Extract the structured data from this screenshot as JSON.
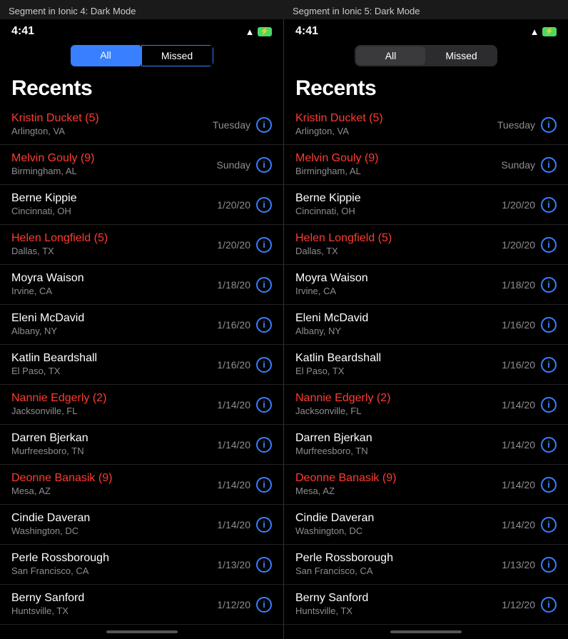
{
  "captions": {
    "left": "Segment in Ionic 4: Dark Mode",
    "right": "Segment in Ionic 5: Dark Mode"
  },
  "statusBar": {
    "time": "4:41",
    "wifi": "📶",
    "battery": "⚡"
  },
  "segment": {
    "allLabel": "All",
    "missedLabel": "Missed"
  },
  "recentsTitle": "Recents",
  "contacts": [
    {
      "name": "Kristin Ducket (5)",
      "location": "Arlington, VA",
      "date": "Tuesday",
      "missed": true
    },
    {
      "name": "Melvin Gouly (9)",
      "location": "Birmingham, AL",
      "date": "Sunday",
      "missed": true
    },
    {
      "name": "Berne Kippie",
      "location": "Cincinnati, OH",
      "date": "1/20/20",
      "missed": false
    },
    {
      "name": "Helen Longfield (5)",
      "location": "Dallas, TX",
      "date": "1/20/20",
      "missed": true
    },
    {
      "name": "Moyra Waison",
      "location": "Irvine, CA",
      "date": "1/18/20",
      "missed": false
    },
    {
      "name": "Eleni McDavid",
      "location": "Albany, NY",
      "date": "1/16/20",
      "missed": false
    },
    {
      "name": "Katlin Beardshall",
      "location": "El Paso, TX",
      "date": "1/16/20",
      "missed": false
    },
    {
      "name": "Nannie Edgerly (2)",
      "location": "Jacksonville, FL",
      "date": "1/14/20",
      "missed": true
    },
    {
      "name": "Darren Bjerkan",
      "location": "Murfreesboro, TN",
      "date": "1/14/20",
      "missed": false
    },
    {
      "name": "Deonne Banasik (9)",
      "location": "Mesa, AZ",
      "date": "1/14/20",
      "missed": true
    },
    {
      "name": "Cindie Daveran",
      "location": "Washington, DC",
      "date": "1/14/20",
      "missed": false
    },
    {
      "name": "Perle Rossborough",
      "location": "San Francisco, CA",
      "date": "1/13/20",
      "missed": false
    },
    {
      "name": "Berny Sanford",
      "location": "Huntsville, TX",
      "date": "1/12/20",
      "missed": false
    }
  ]
}
